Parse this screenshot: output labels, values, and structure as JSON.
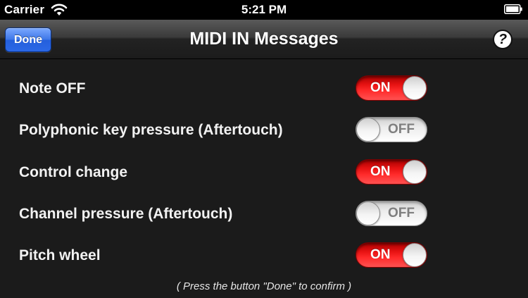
{
  "status_bar": {
    "carrier": "Carrier",
    "time": "5:21 PM",
    "icons": [
      "wifi-icon",
      "battery-icon"
    ]
  },
  "nav_bar": {
    "done_label": "Done",
    "title": "MIDI IN Messages",
    "help_label": "?",
    "help_icon": "question-mark-icon"
  },
  "settings": [
    {
      "label": "Note OFF",
      "state": "ON"
    },
    {
      "label": "Polyphonic key pressure (Aftertouch)",
      "state": "OFF"
    },
    {
      "label": "Control change",
      "state": "ON"
    },
    {
      "label": "Channel pressure (Aftertouch)",
      "state": "OFF"
    },
    {
      "label": "Pitch wheel",
      "state": "ON"
    }
  ],
  "footer": {
    "note": "( Press the button \"Done\" to confirm )"
  },
  "colors": {
    "background": "#1b1b1b",
    "toggle_on": "#e61212",
    "toggle_off": "#ececec",
    "done_button": "#2b68e6"
  }
}
